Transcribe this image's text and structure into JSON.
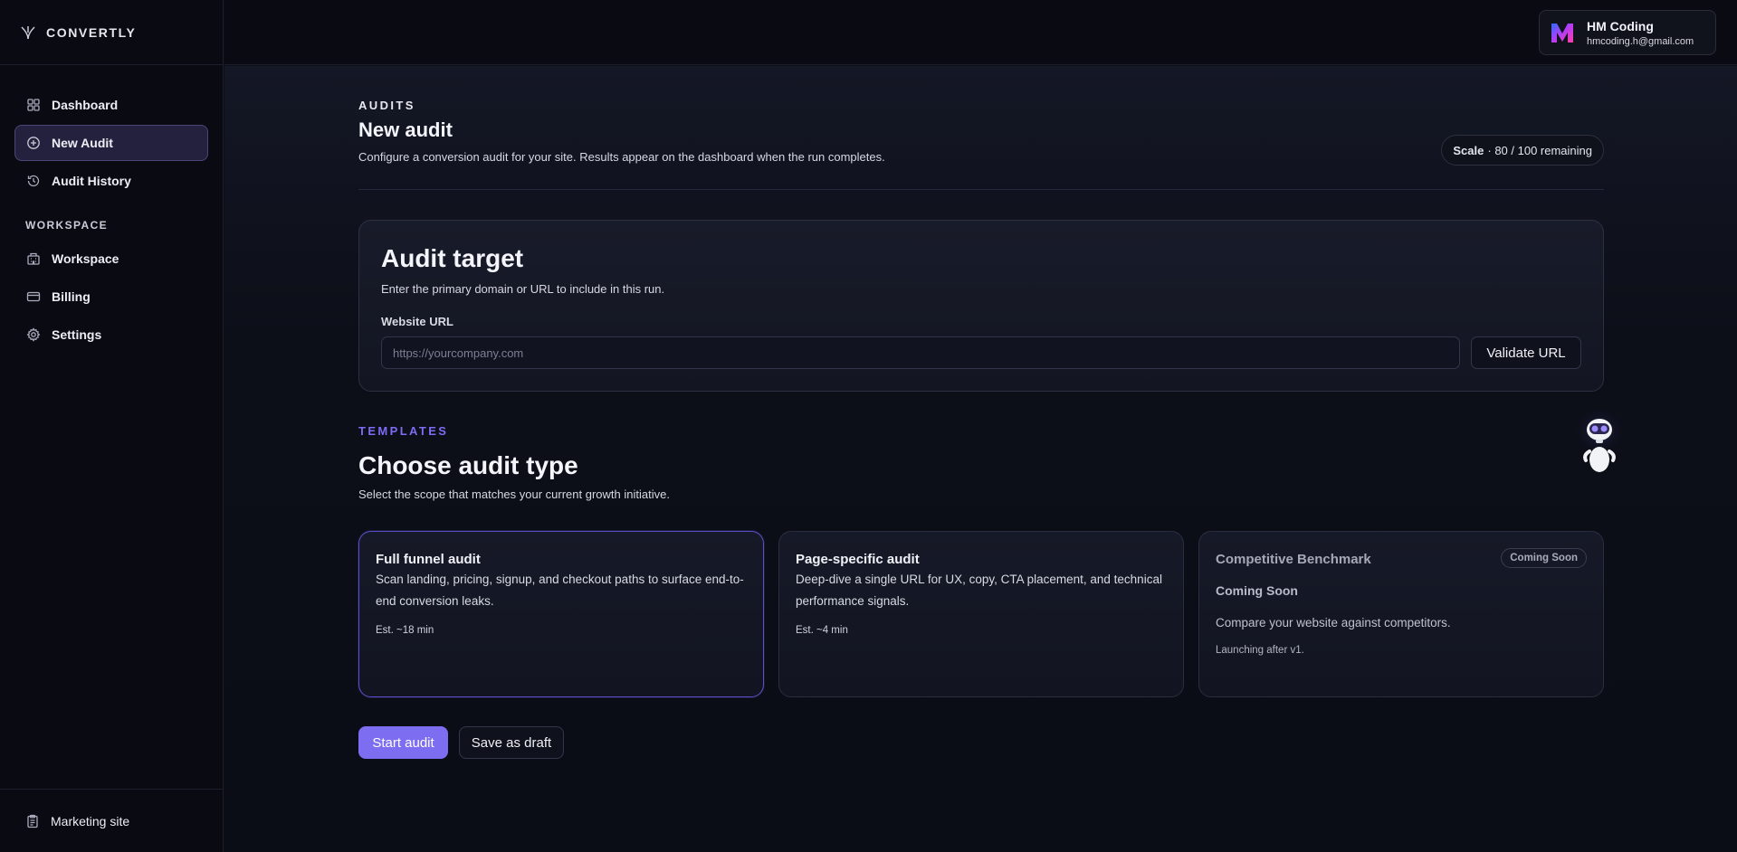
{
  "brand": {
    "name": "CONVERTLY",
    "icon": "convertly-logo-icon"
  },
  "sidebar": {
    "items": [
      {
        "label": "Dashboard",
        "icon": "grid-icon",
        "active": false
      },
      {
        "label": "New Audit",
        "icon": "plus-circle-icon",
        "active": true
      },
      {
        "label": "Audit History",
        "icon": "history-icon",
        "active": false
      }
    ],
    "section_label": "WORKSPACE",
    "workspace_items": [
      {
        "label": "Workspace",
        "icon": "building-icon"
      },
      {
        "label": "Billing",
        "icon": "credit-card-icon"
      },
      {
        "label": "Settings",
        "icon": "gear-icon"
      }
    ],
    "footer": {
      "label": "Marketing site",
      "icon": "clipboard-icon"
    }
  },
  "user": {
    "name": "HM Coding",
    "email": "hmcoding.h@gmail.com",
    "logo": "m-gradient-logo"
  },
  "header": {
    "eyebrow": "AUDITS",
    "title": "New audit",
    "subtitle": "Configure a conversion audit for your site. Results appear on the dashboard when the run completes.",
    "scale_label": "Scale",
    "scale_value": "· 80 / 100 remaining"
  },
  "target": {
    "title": "Audit target",
    "subtitle": "Enter the primary domain or URL to include in this run.",
    "field_label": "Website URL",
    "placeholder": "https://yourcompany.com",
    "value": "",
    "validate_label": "Validate URL"
  },
  "templates": {
    "eyebrow": "TEMPLATES",
    "title": "Choose audit type",
    "subtitle": "Select the scope that matches your current growth initiative.",
    "cards": [
      {
        "title": "Full funnel audit",
        "description": "Scan landing, pricing, signup, and checkout paths to surface end-to-end conversion leaks.",
        "estimate": "Est. ~18 min",
        "selected": true
      },
      {
        "title": "Page-specific audit",
        "description": "Deep-dive a single URL for UX, copy, CTA placement, and technical performance signals.",
        "estimate": "Est. ~4 min",
        "selected": false
      },
      {
        "title": "Competitive Benchmark",
        "badge": "Coming Soon",
        "subtitle": "Coming Soon",
        "description": "Compare your website against competitors.",
        "note": "Launching after v1.",
        "disabled": true
      }
    ]
  },
  "actions": {
    "start_label": "Start audit",
    "draft_label": "Save as draft"
  },
  "assistant": {
    "icon": "robot-assistant-icon"
  },
  "colors": {
    "accent": "#7d6df0",
    "background": "#0b0d17",
    "selected_border": "#5a50c9"
  }
}
